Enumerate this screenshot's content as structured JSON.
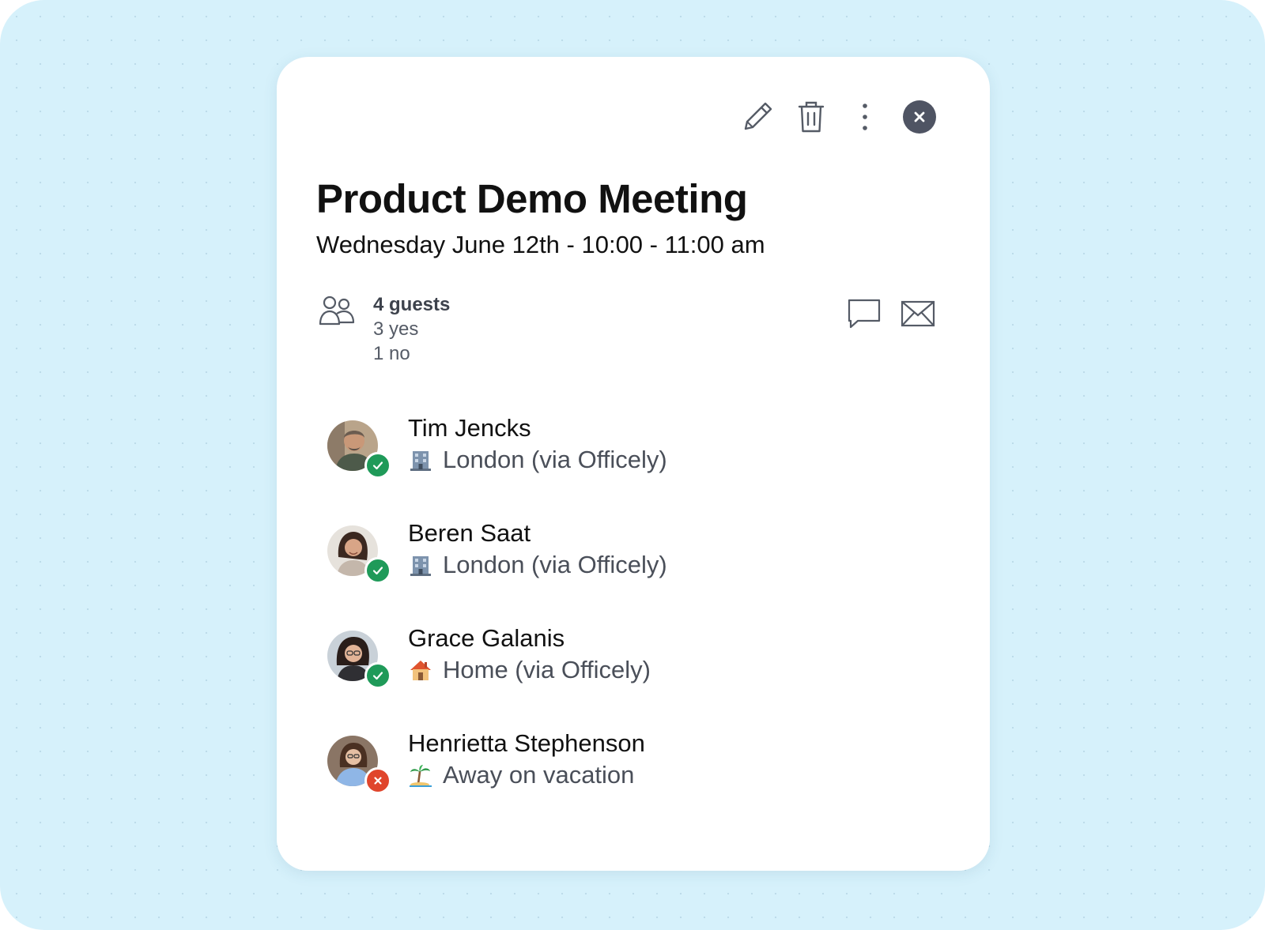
{
  "event": {
    "title": "Product Demo Meeting",
    "datetime": "Wednesday June 12th - 10:00 - 11:00 am"
  },
  "toolbar": {
    "icons": [
      "pencil-icon",
      "trash-icon",
      "more-vertical-icon",
      "close-icon"
    ]
  },
  "guests": {
    "count_label": "4 guests",
    "yes_label": "3 yes",
    "no_label": "1 no",
    "actions": [
      "chat-icon",
      "mail-icon"
    ]
  },
  "attendees": [
    {
      "name": "Tim Jencks",
      "location": "London (via Officely)",
      "location_icon": "office-building-icon",
      "status": "yes"
    },
    {
      "name": "Beren Saat",
      "location": "London (via Officely)",
      "location_icon": "office-building-icon",
      "status": "yes"
    },
    {
      "name": "Grace Galanis",
      "location": "Home (via Officely)",
      "location_icon": "house-icon",
      "status": "yes"
    },
    {
      "name": "Henrietta Stephenson",
      "location": "Away on vacation",
      "location_icon": "palm-island-icon",
      "status": "no"
    }
  ],
  "colors": {
    "background": "#d6f1fb",
    "card": "#ffffff",
    "accepted": "#1f9a59",
    "declined": "#e0452c",
    "close_button": "#4f5463"
  }
}
